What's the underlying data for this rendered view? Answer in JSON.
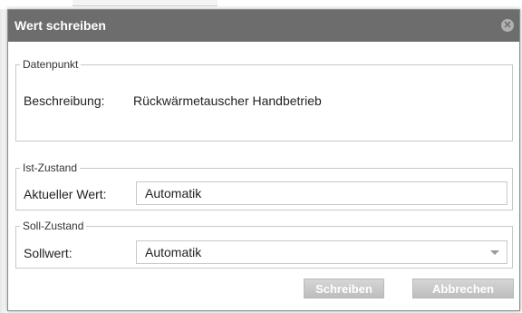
{
  "dialog": {
    "title": "Wert schreiben",
    "close_icon": "close-icon"
  },
  "datenpunkt": {
    "legend": "Datenpunkt",
    "description_label": "Beschreibung:",
    "description_value": "Rückwärmetauscher Handbetrieb"
  },
  "ist_zustand": {
    "legend": "Ist-Zustand",
    "current_label": "Aktueller Wert:",
    "current_value": "Automatik"
  },
  "soll_zustand": {
    "legend": "Soll-Zustand",
    "setpoint_label": "Sollwert:",
    "setpoint_selected": "Automatik"
  },
  "buttons": {
    "write_label": "Schreiben",
    "cancel_label": "Abbrechen"
  },
  "colors": {
    "titlebar": "#6d6d6d",
    "button": "#c9c9c9",
    "border": "#c8c8c8"
  }
}
